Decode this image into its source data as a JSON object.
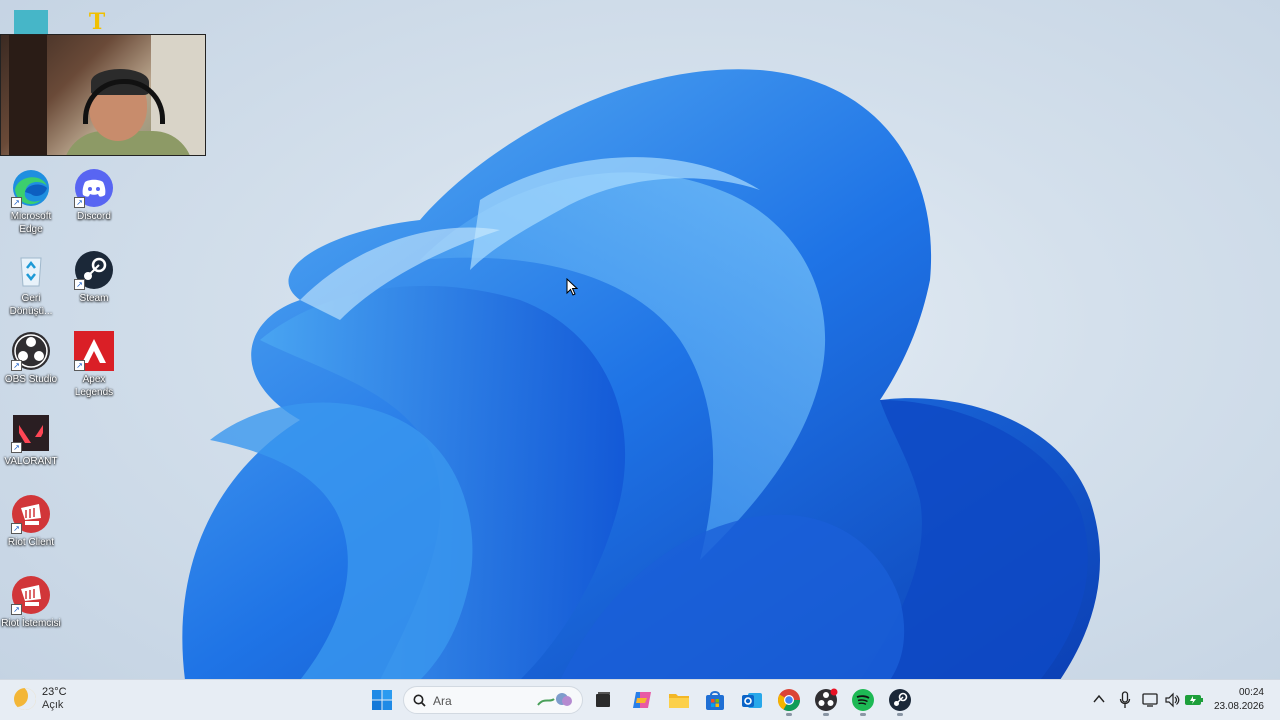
{
  "desktop": {
    "icons": [
      {
        "id": "edge",
        "label": "Microsoft Edge"
      },
      {
        "id": "discord",
        "label": "Discord"
      },
      {
        "id": "recycle",
        "label": "Geri Dönüşü..."
      },
      {
        "id": "steam",
        "label": "Steam"
      },
      {
        "id": "obs",
        "label": "OBS Studio"
      },
      {
        "id": "apex",
        "label": "Apex Legends"
      },
      {
        "id": "valorant",
        "label": "VALORANT"
      },
      {
        "id": "riot1",
        "label": "Riot Client"
      },
      {
        "id": "riot2",
        "label": "Riot İstemcisi"
      }
    ],
    "top_icons": [
      "teal-app-icon",
      "gold-logo-icon"
    ]
  },
  "taskbar": {
    "weather": {
      "temp": "23°C",
      "condition": "Açık"
    },
    "search_placeholder": "Ara",
    "apps": [
      "start-icon",
      "search-icon",
      "task-view-icon",
      "copilot-icon",
      "file-explorer-icon",
      "store-icon",
      "outlook-icon",
      "chrome-icon",
      "obs-icon",
      "spotify-icon",
      "steam-icon"
    ],
    "clock": {
      "time": "00:24",
      "date": "23.08.2026"
    }
  },
  "colors": {
    "accent": "#0067c0",
    "taskbar": "#e7edf4"
  }
}
